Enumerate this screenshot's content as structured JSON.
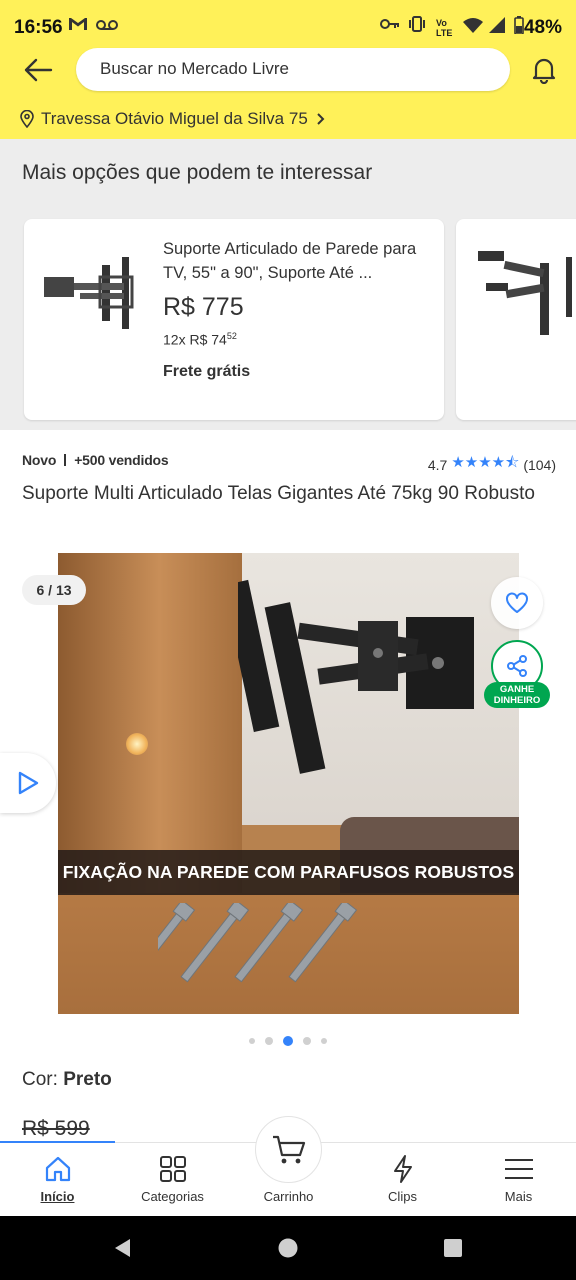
{
  "status_bar": {
    "time": "16:56",
    "battery": "48%",
    "icons": [
      "gmail-icon",
      "voicemail-icon",
      "key-icon",
      "vibrate-icon",
      "volte-icon",
      "wifi-icon",
      "signal-icon",
      "battery-icon"
    ]
  },
  "header": {
    "search_placeholder": "Buscar no Mercado Livre",
    "address": "Travessa Otávio Miguel da Silva 75"
  },
  "recommendations": {
    "title": "Mais opções que podem te interessar",
    "items": [
      {
        "title": "Suporte Articulado de Parede para TV, 55\" a 90\", Suporte Até ...",
        "price": "R$ 775",
        "installments": "12x R$ 74",
        "installments_cents": "52",
        "shipping": "Frete grátis"
      }
    ]
  },
  "product": {
    "condition": "Novo",
    "sold": "+500 vendidos",
    "rating_value": "4.7",
    "rating_stars": "★★★★⯪",
    "rating_count": "(104)",
    "title": "Suporte Multi Articulado Telas Gigantes Até 75kg 90 Robusto",
    "gallery_counter": "6 / 13",
    "gallery_banner": "FIXAÇÃO NA PAREDE COM PARAFUSOS ROBUSTOS",
    "earn_badge_line1": "GANHE",
    "earn_badge_line2": "DINHEIRO",
    "color_label": "Cor: ",
    "color_value": "Preto",
    "old_price": "R$ 599"
  },
  "tabs": [
    {
      "label": "Início",
      "icon": "home-icon",
      "active": true
    },
    {
      "label": "Categorias",
      "icon": "grid-icon"
    },
    {
      "label": "Carrinho",
      "icon": "cart-icon"
    },
    {
      "label": "Clips",
      "icon": "bolt-icon"
    },
    {
      "label": "Mais",
      "icon": "menu-icon"
    }
  ],
  "colors": {
    "brand_yellow": "#fff159",
    "accent_blue": "#3483fa",
    "green": "#00a650"
  }
}
